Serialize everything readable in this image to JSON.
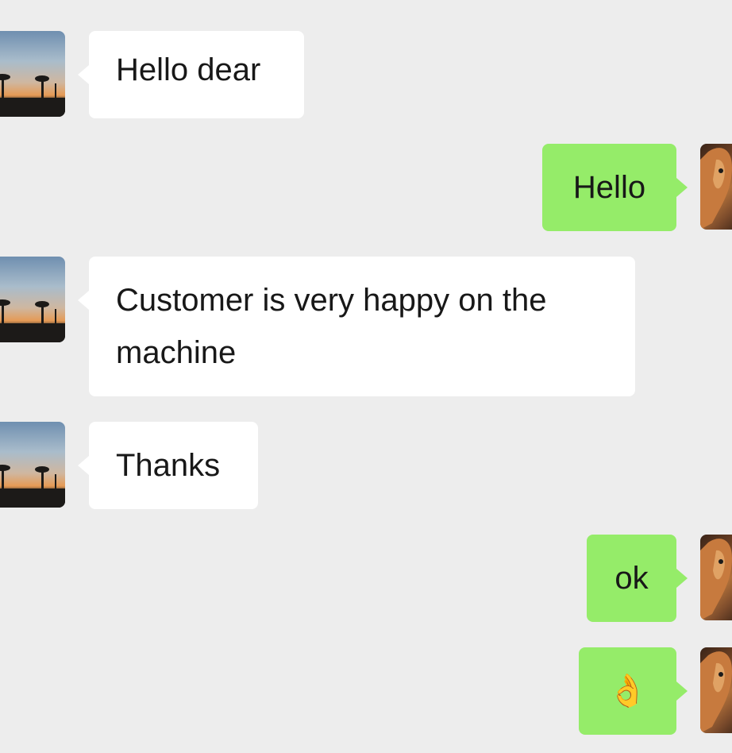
{
  "conversation": {
    "messages": [
      {
        "side": "in",
        "text": "Hello dear"
      },
      {
        "side": "out",
        "text": "Hello"
      },
      {
        "side": "in",
        "text": "Customer is very happy on the machine"
      },
      {
        "side": "in",
        "text": "Thanks"
      },
      {
        "side": "out",
        "text": "ok"
      },
      {
        "side": "out",
        "text": "👌"
      }
    ]
  },
  "colors": {
    "background": "#ededed",
    "incoming_bubble": "#ffffff",
    "outgoing_bubble": "#95ec69",
    "text": "#181818"
  },
  "icons": {
    "contact_avatar": "sunset-baobab-avatar",
    "self_avatar": "animal-avatar",
    "emoji": "ok-hand-emoji"
  }
}
